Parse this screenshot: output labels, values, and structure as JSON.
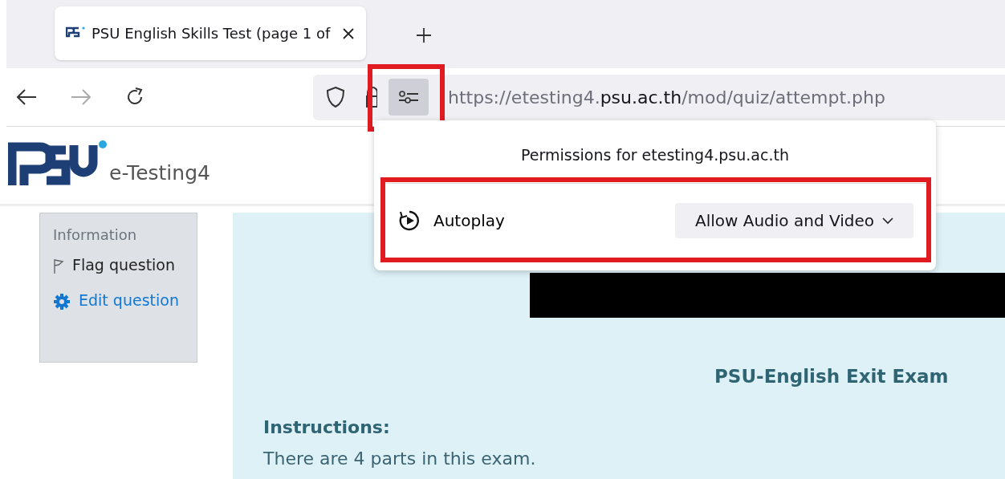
{
  "browser": {
    "tabs": [
      {
        "title": "PSU English Skills Test (page 1 of",
        "selected": true
      }
    ],
    "url": {
      "host_prefix": "https://etesting4.",
      "domain": "psu.ac.th",
      "path": "/mod/quiz/attempt.php"
    },
    "permissions_button": {
      "highlighted": true
    }
  },
  "permissions_popup": {
    "title": "Permissions for etesting4.psu.ac.th",
    "items": [
      {
        "label": "Autoplay",
        "value": "Allow Audio and Video",
        "highlighted": true
      }
    ]
  },
  "site": {
    "name": "e-Testing4"
  },
  "question_info": {
    "heading": "Information",
    "links": [
      {
        "kind": "flag",
        "label": "Flag question"
      },
      {
        "kind": "edit",
        "label": "Edit question"
      }
    ]
  },
  "content": {
    "redacted": true,
    "title": "PSU-English Exit Exam",
    "instructions_heading": "Instructions:",
    "instructions": "There are 4 parts in this exam."
  }
}
